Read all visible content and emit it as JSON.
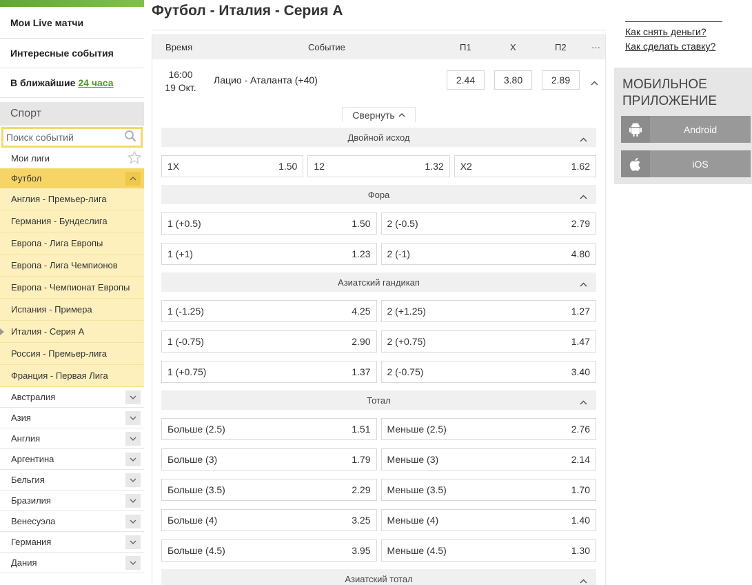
{
  "sidebar": {
    "live": "Мои Live матчи",
    "interesting": "Интересные события",
    "soon_prefix": "В ближайшие",
    "soon_link": "24 часа",
    "sport_header": "Спорт",
    "search_placeholder": "Поиск событий",
    "my_leagues": "Мои лиги",
    "football": "Футбол",
    "leagues": [
      "Англия - Премьер-лига",
      "Германия - Бундеслига",
      "Европа - Лига Европы",
      "Европа - Лига Чемпионов",
      "Европа - Чемпионат Европы",
      "Испания - Примера",
      "Италия - Серия А",
      "Россия - Премьер-лига",
      "Франция - Первая Лига"
    ],
    "active_league": "Италия - Серия А",
    "countries": [
      "Австралия",
      "Азия",
      "Англия",
      "Аргентина",
      "Бельгия",
      "Бразилия",
      "Венесуэла",
      "Германия",
      "Дания"
    ]
  },
  "main": {
    "title": "Футбол - Италия - Серия А",
    "columns": {
      "time": "Время",
      "event": "Событие",
      "p1": "П1",
      "x": "X",
      "p2": "П2",
      "more": "···"
    },
    "event": {
      "time": "16:00",
      "date": "19 Окт.",
      "name": "Лацио - Аталанта (+40)",
      "p1": "2.44",
      "x": "3.80",
      "p2": "2.89"
    },
    "collapse_label": "Свернуть",
    "markets": [
      {
        "title": "Двойной исход",
        "rows": [
          [
            [
              "1X",
              "1.50"
            ],
            [
              "12",
              "1.32"
            ],
            [
              "X2",
              "1.62"
            ]
          ]
        ]
      },
      {
        "title": "Фора",
        "rows": [
          [
            [
              "1 (+0.5)",
              "1.50"
            ],
            [
              "2 (-0.5)",
              "2.79"
            ]
          ],
          [
            [
              "1 (+1)",
              "1.23"
            ],
            [
              "2 (-1)",
              "4.80"
            ]
          ]
        ]
      },
      {
        "title": "Азиатский гандикап",
        "rows": [
          [
            [
              "1 (-1.25)",
              "4.25"
            ],
            [
              "2 (+1.25)",
              "1.27"
            ]
          ],
          [
            [
              "1 (-0.75)",
              "2.90"
            ],
            [
              "2 (+0.75)",
              "1.47"
            ]
          ],
          [
            [
              "1 (+0.75)",
              "1.37"
            ],
            [
              "2 (-0.75)",
              "3.40"
            ]
          ]
        ]
      },
      {
        "title": "Тотал",
        "rows": [
          [
            [
              "Больше (2.5)",
              "1.51"
            ],
            [
              "Меньше (2.5)",
              "2.76"
            ]
          ],
          [
            [
              "Больше (3)",
              "1.79"
            ],
            [
              "Меньше (3)",
              "2.14"
            ]
          ],
          [
            [
              "Больше (3.5)",
              "2.29"
            ],
            [
              "Меньше (3.5)",
              "1.70"
            ]
          ],
          [
            [
              "Больше (4)",
              "3.25"
            ],
            [
              "Меньше (4)",
              "1.40"
            ]
          ],
          [
            [
              "Больше (4.5)",
              "3.95"
            ],
            [
              "Меньше (4.5)",
              "1.30"
            ]
          ]
        ]
      },
      {
        "title": "Азиатский тотал",
        "rows": []
      }
    ]
  },
  "right": {
    "withdraw_link": "Как снять деньги?",
    "bet_link": "Как сделать ставку?",
    "mobile_title_1": "Мобильное",
    "mobile_title_2": "приложение",
    "android": "Android",
    "ios": "iOS"
  },
  "colors": {
    "accent_green": "#4a9a1e",
    "football_yellow": "#f7d565",
    "league_yellow": "#fdf0bd"
  }
}
